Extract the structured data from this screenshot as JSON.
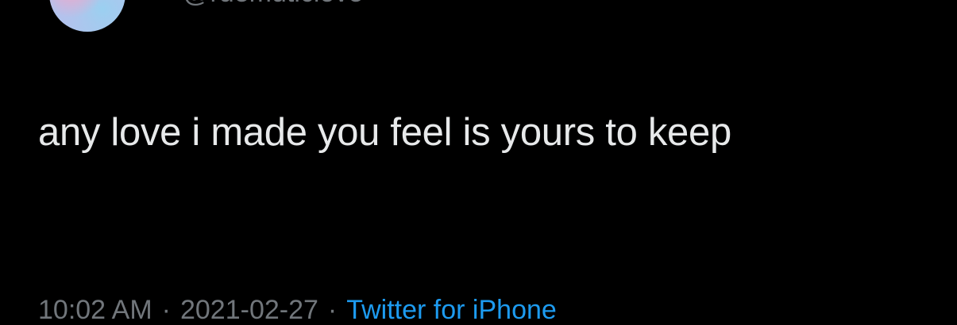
{
  "tweet": {
    "handle": "@ruemuticlove",
    "text": "any love i made you feel is yours to keep",
    "time": "10:02 AM",
    "date": "2021-02-27",
    "separator": "·",
    "source": "Twitter for iPhone"
  },
  "colors": {
    "background": "#000000",
    "text": "#e7e9ea",
    "secondary": "#71767b",
    "accent": "#1d9bf0"
  }
}
